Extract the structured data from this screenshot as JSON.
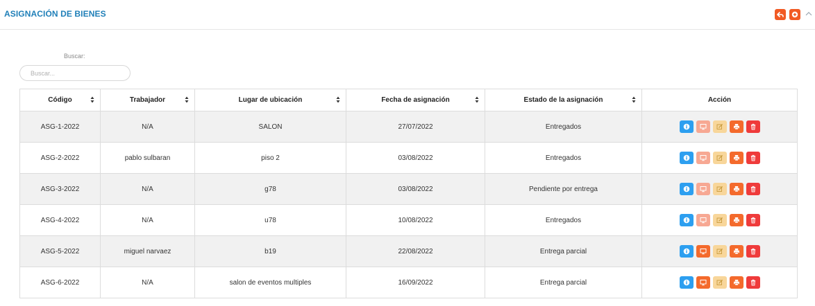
{
  "page": {
    "title": "ASIGNACIÓN DE BIENES",
    "accent": "#1f7fb8",
    "header_icons": [
      "undo-icon",
      "plus-icon",
      "chevron-up-icon"
    ]
  },
  "search": {
    "label": "Buscar:",
    "placeholder": "Buscar...",
    "value": ""
  },
  "table": {
    "columns": [
      "Código",
      "Trabajador",
      "Lugar de ubicación",
      "Fecha de asignación",
      "Estado de la asignación",
      "Acción"
    ],
    "rows": [
      {
        "codigo": "ASG-1-2022",
        "trabajador": "N/A",
        "lugar": "SALON",
        "fecha": "27/07/2022",
        "estado": "Entregados",
        "monitor_active": false
      },
      {
        "codigo": "ASG-2-2022",
        "trabajador": "pablo sulbaran",
        "lugar": "piso 2",
        "fecha": "03/08/2022",
        "estado": "Entregados",
        "monitor_active": false
      },
      {
        "codigo": "ASG-3-2022",
        "trabajador": "N/A",
        "lugar": "g78",
        "fecha": "03/08/2022",
        "estado": "Pendiente por entrega",
        "monitor_active": false
      },
      {
        "codigo": "ASG-4-2022",
        "trabajador": "N/A",
        "lugar": "u78",
        "fecha": "10/08/2022",
        "estado": "Entregados",
        "monitor_active": false
      },
      {
        "codigo": "ASG-5-2022",
        "trabajador": "miguel narvaez",
        "lugar": "b19",
        "fecha": "22/08/2022",
        "estado": "Entrega parcial",
        "monitor_active": true
      },
      {
        "codigo": "ASG-6-2022",
        "trabajador": "N/A",
        "lugar": "salon de eventos multiples",
        "fecha": "16/09/2022",
        "estado": "Entrega parcial",
        "monitor_active": true
      }
    ],
    "action_icons": [
      "info-icon",
      "monitor-icon",
      "edit-icon",
      "print-icon",
      "trash-icon"
    ]
  }
}
